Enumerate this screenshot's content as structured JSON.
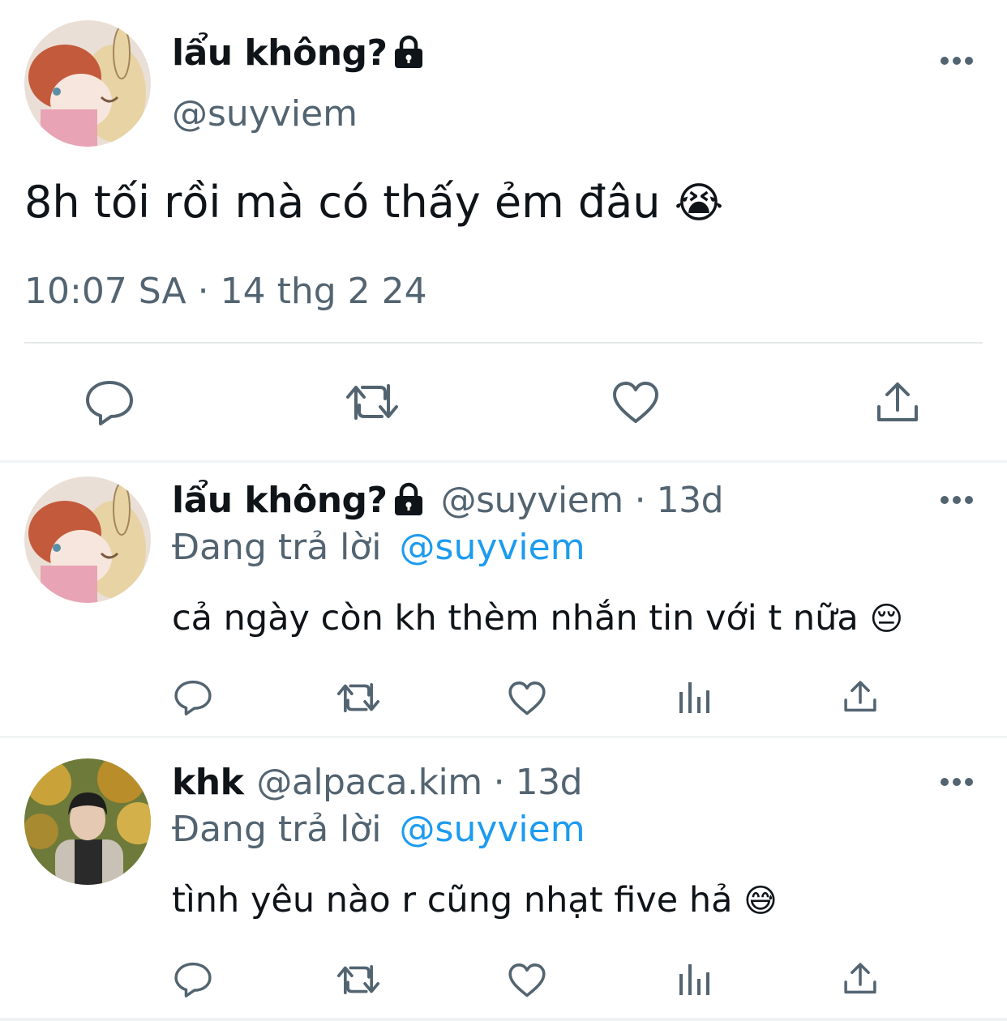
{
  "main_tweet": {
    "display_name": "lẩu không?",
    "handle": "@suyviem",
    "text": "8h tối rồi mà có thấy ẻm đâu",
    "emoji": "😭",
    "timestamp": "10:07 SA · 14 thg 2 24",
    "protected_icon": "lock-icon",
    "actions": [
      "reply-icon",
      "retweet-icon",
      "like-icon",
      "share-icon"
    ]
  },
  "replies": [
    {
      "display_name": "lẩu không?",
      "handle": "@suyviem",
      "age": "· 13d",
      "replying_prefix": "Đang trả lời",
      "replying_to": "@suyviem",
      "text": "cả ngày còn kh thèm nhắn tin với t nữa",
      "emoji": "😔",
      "actions": [
        "reply-icon",
        "retweet-icon",
        "like-icon",
        "views-icon",
        "share-icon"
      ]
    },
    {
      "display_name": "khk",
      "handle": "@alpaca.kim",
      "age": "· 13d",
      "replying_prefix": "Đang trả lời",
      "replying_to": "@suyviem",
      "text": "tình yêu nào r cũng nhạt five hả",
      "emoji": "😅",
      "actions": [
        "reply-icon",
        "retweet-icon",
        "like-icon",
        "views-icon",
        "share-icon"
      ]
    }
  ],
  "colors": {
    "text": "#0f1419",
    "muted": "#536471",
    "link": "#1d9bf0",
    "divider": "#eff3f4"
  }
}
